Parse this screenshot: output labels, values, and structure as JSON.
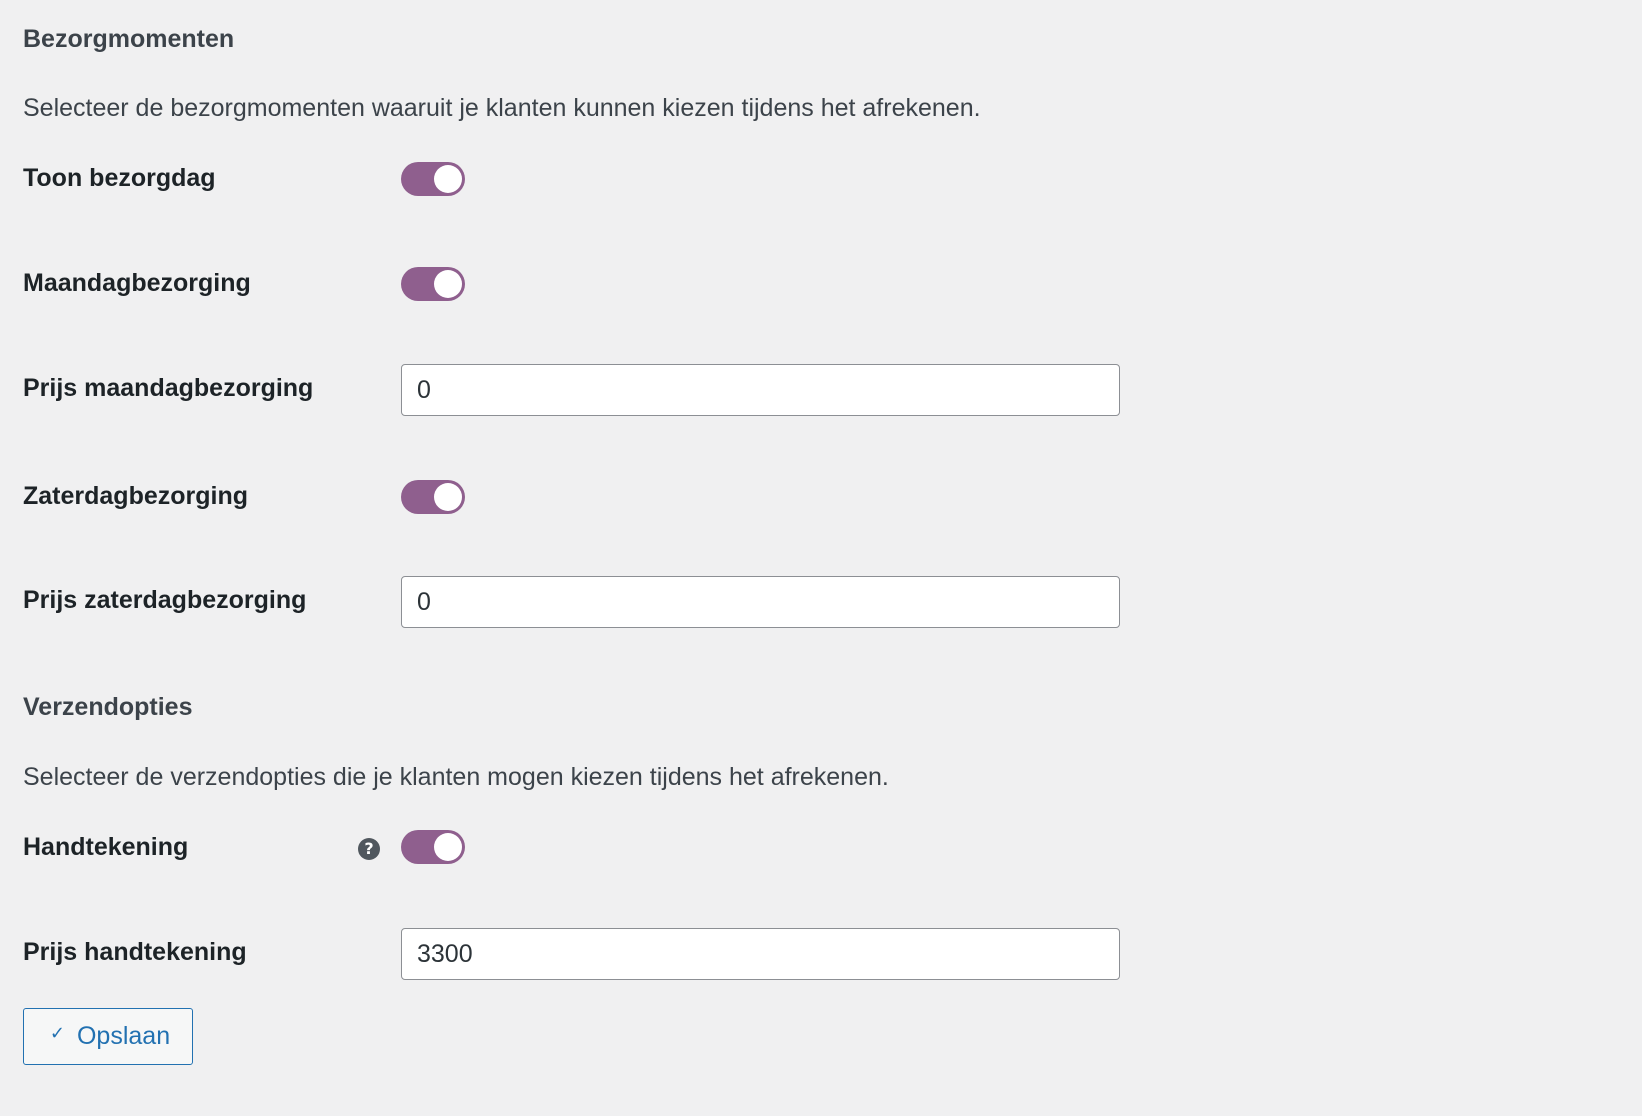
{
  "delivery_section": {
    "title": "Bezorgmomenten",
    "description": "Selecteer de bezorgmomenten waaruit je klanten kunnen kiezen tijdens het afrekenen.",
    "show_delivery_day": {
      "label": "Toon bezorgdag",
      "enabled": true
    },
    "monday_delivery": {
      "label": "Maandagbezorging",
      "enabled": true
    },
    "monday_price": {
      "label": "Prijs maandagbezorging",
      "value": "0"
    },
    "saturday_delivery": {
      "label": "Zaterdagbezorging",
      "enabled": true
    },
    "saturday_price": {
      "label": "Prijs zaterdagbezorging",
      "value": "0"
    }
  },
  "shipping_section": {
    "title": "Verzendopties",
    "description": "Selecteer de verzendopties die je klanten mogen kiezen tijdens het afrekenen.",
    "signature": {
      "label": "Handtekening",
      "enabled": true,
      "help_icon": "?"
    },
    "signature_price": {
      "label": "Prijs handtekening",
      "value": "3300"
    }
  },
  "save_button": {
    "label": "Opslaan",
    "icon": "check-icon"
  },
  "colors": {
    "toggle_on": "#8f5f8e",
    "button_accent": "#2271b1",
    "background": "#f0f0f1"
  }
}
